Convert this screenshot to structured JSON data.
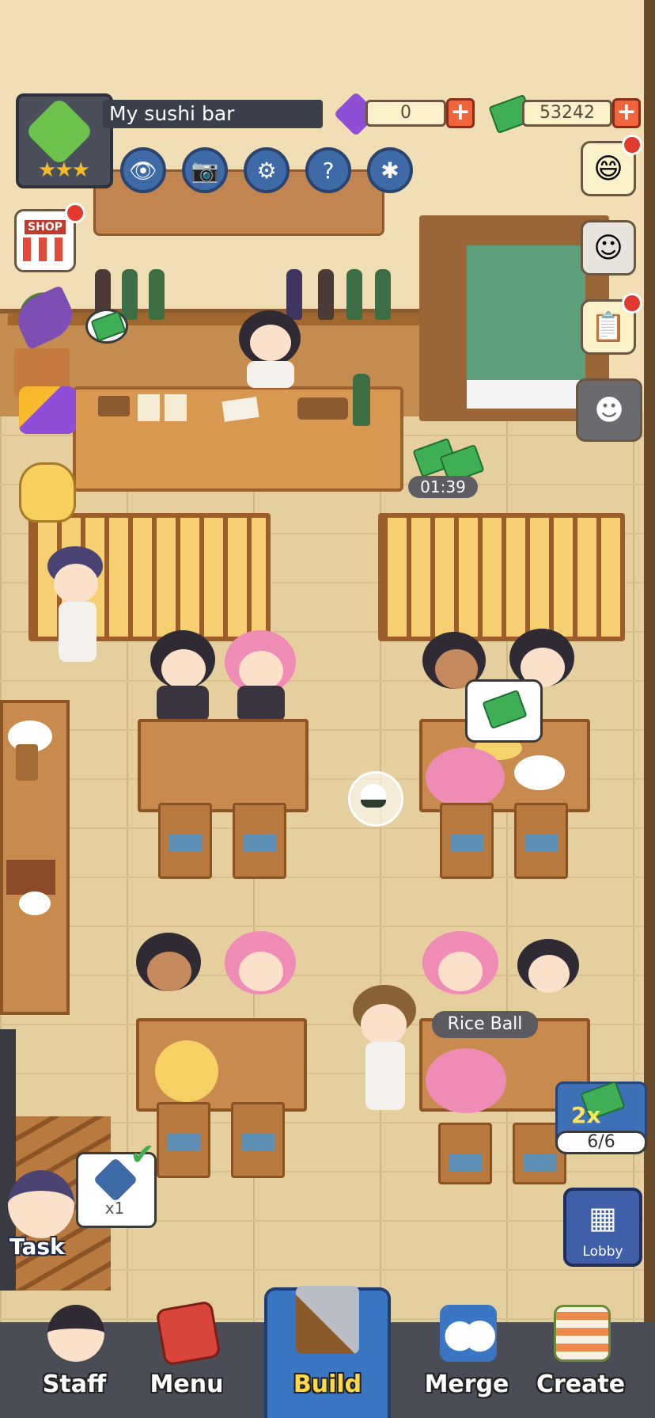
{
  "hud": {
    "restaurant_name": "My sushi bar",
    "stars": "★★★",
    "gems": "0",
    "cash": "53242",
    "plus": "+"
  },
  "tool_buttons": [
    {
      "name": "view-button",
      "icon": "eye-icon",
      "glyph": "👁"
    },
    {
      "name": "camera-button",
      "icon": "camera-icon",
      "glyph": "📷"
    },
    {
      "name": "settings-button",
      "icon": "gear-icon",
      "glyph": "⚙"
    },
    {
      "name": "help-button",
      "icon": "question-icon",
      "glyph": "?"
    },
    {
      "name": "album-button",
      "icon": "card-icon",
      "glyph": "✱"
    }
  ],
  "left_buttons": {
    "shop_label": "SHOP"
  },
  "right_buttons": {
    "emoji_glyph": "😄",
    "chef_glyph": "☺",
    "clipboard_glyph": "📋",
    "laugh_glyph": "☻"
  },
  "scene": {
    "counter_timer": "01:39",
    "order_bubble_item": "Rice Ball"
  },
  "boost": {
    "multiplier": "2x",
    "count": "6/6"
  },
  "lobby": {
    "label": "Lobby",
    "icon_glyph": "▦"
  },
  "task": {
    "label": "Task",
    "reward_count": "x1",
    "check_glyph": "✔"
  },
  "nav": {
    "staff": "Staff",
    "menu": "Menu",
    "build": "Build",
    "merge": "Merge",
    "create": "Create"
  },
  "colors": {
    "accent_blue": "#3f6aa8",
    "cash_green": "#3eaf55",
    "notice_red": "#e23a2c",
    "build_label": "#ffd94a"
  }
}
